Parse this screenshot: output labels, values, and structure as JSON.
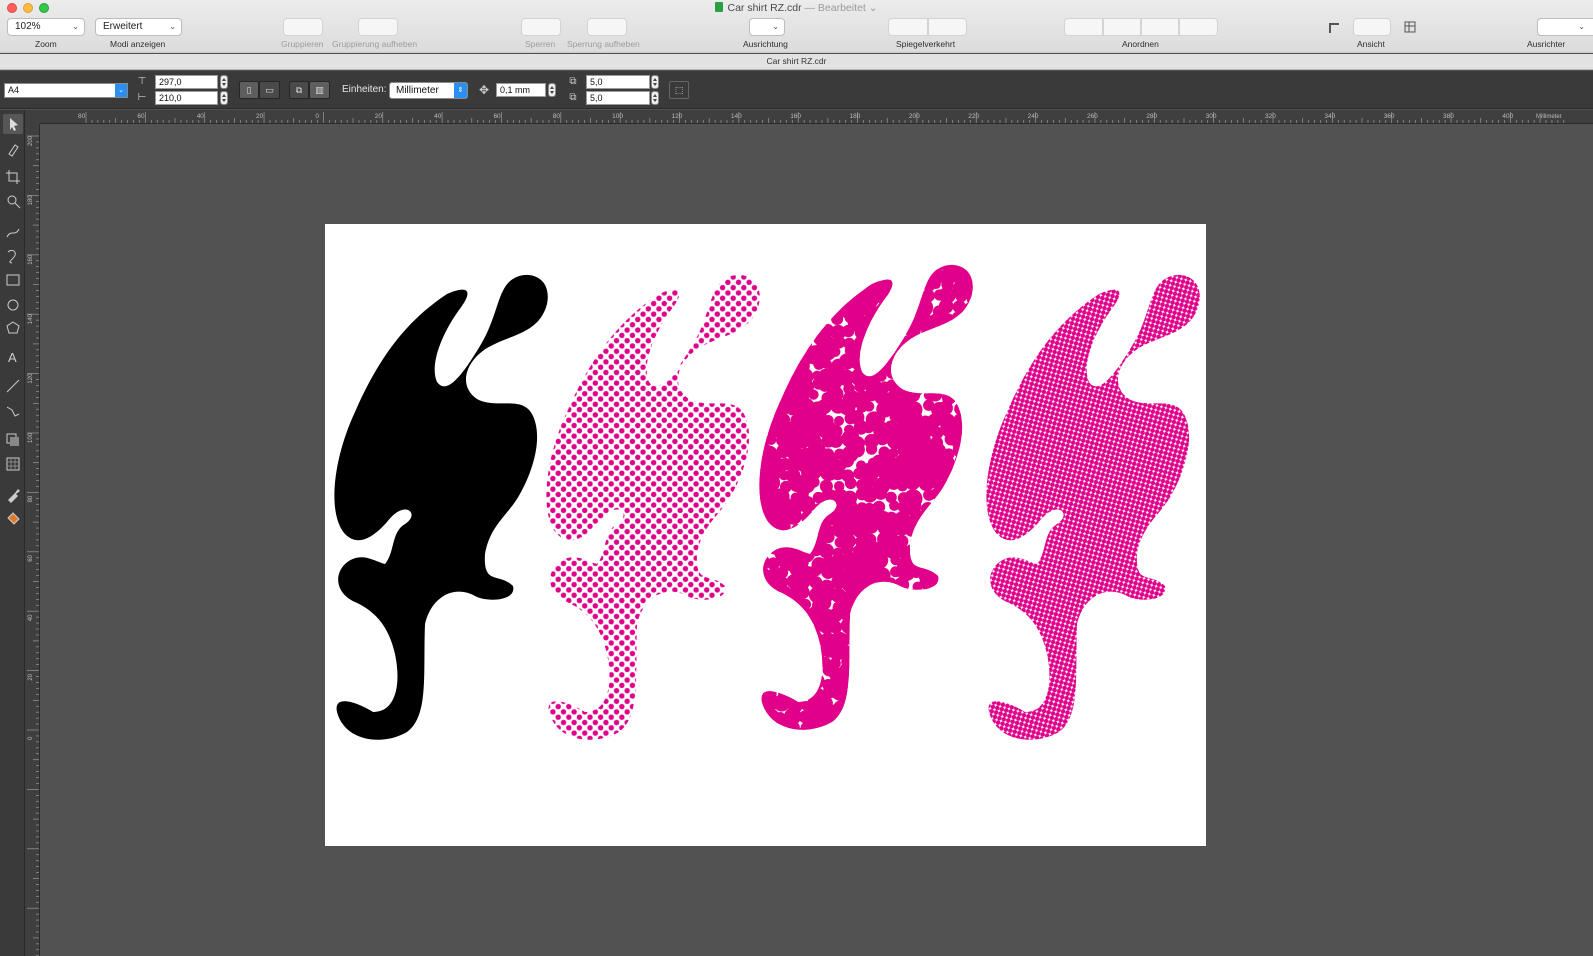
{
  "window": {
    "title": "Car shirt RZ.cdr",
    "edited_label": "— Bearbeitet",
    "document_tab": "Car shirt RZ.cdr"
  },
  "toolbar": {
    "zoom_value": "102%",
    "zoom_label": "Zoom",
    "mode_value": "Erweitert",
    "mode_label": "Modi anzeigen",
    "group_label": "Gruppieren",
    "ungroup_label": "Gruppierung aufheben",
    "lock_label": "Sperren",
    "unlock_label": "Sperrung aufheben",
    "align_label": "Ausrichtung",
    "mirror_label": "Spiegelverkehrt",
    "arrange_label": "Anordnen",
    "view_label": "Ansicht",
    "align2_label": "Ausrichter"
  },
  "propbar": {
    "page_preset": "A4",
    "width_value": "297,0",
    "height_value": "210,0",
    "units_label": "Einheiten:",
    "units_value": "Millimeter",
    "nudge_value": "0,1 mm",
    "dup_x_value": "5,0",
    "dup_y_value": "5,0"
  },
  "ruler": {
    "unit_label": "Millimeter",
    "h_ticks": [
      "80",
      "60",
      "40",
      "20",
      "0",
      "20",
      "40",
      "60",
      "80",
      "100",
      "120",
      "140",
      "160",
      "180",
      "200",
      "220",
      "240",
      "260",
      "280",
      "300",
      "320",
      "340",
      "360",
      "380",
      "400"
    ],
    "v_ticks": [
      "200",
      "180",
      "160",
      "140",
      "120",
      "100",
      "80",
      "60",
      "40",
      "20",
      "0"
    ]
  },
  "artwork": {
    "colors": {
      "black": "#000000",
      "magenta": "#e0008a",
      "page": "#ffffff",
      "desk": "#525252"
    }
  },
  "tools": [
    "pick-tool-icon",
    "shape-tool-icon",
    "crop-tool-icon",
    "zoom-tool-icon",
    "freehand-tool-icon",
    "smart-fill-icon",
    "rectangle-tool-icon",
    "ellipse-tool-icon",
    "polygon-tool-icon",
    "text-tool-icon",
    "parallel-dimension-icon",
    "connector-tool-icon",
    "drop-shadow-icon",
    "transparency-icon",
    "eyedropper-icon",
    "interactive-fill-icon"
  ]
}
